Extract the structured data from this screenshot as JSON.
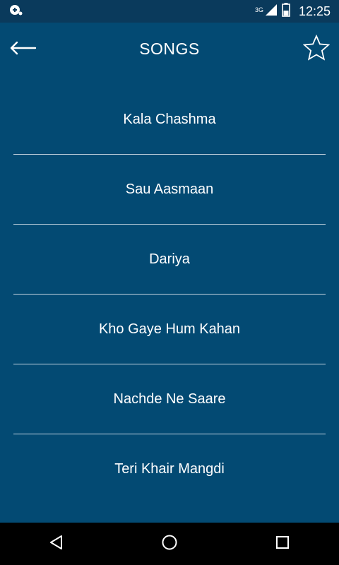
{
  "status_bar": {
    "network_type": "3G",
    "time": "12:25"
  },
  "app_bar": {
    "title": "SONGS",
    "back_icon": "arrow-left-icon",
    "favorite_icon": "star-outline-icon"
  },
  "songs": [
    {
      "title": "Kala Chashma"
    },
    {
      "title": "Sau Aasmaan"
    },
    {
      "title": "Dariya"
    },
    {
      "title": "Kho Gaye Hum Kahan"
    },
    {
      "title": "Nachde Ne Saare"
    },
    {
      "title": "Teri Khair Mangdi"
    }
  ],
  "nav_bar": {
    "back": "triangle-back-icon",
    "home": "circle-home-icon",
    "recents": "square-recents-icon"
  },
  "colors": {
    "background": "#034a73",
    "status_bar": "#0a3a5c",
    "divider": "#c7d6e1",
    "text": "#ffffff"
  }
}
